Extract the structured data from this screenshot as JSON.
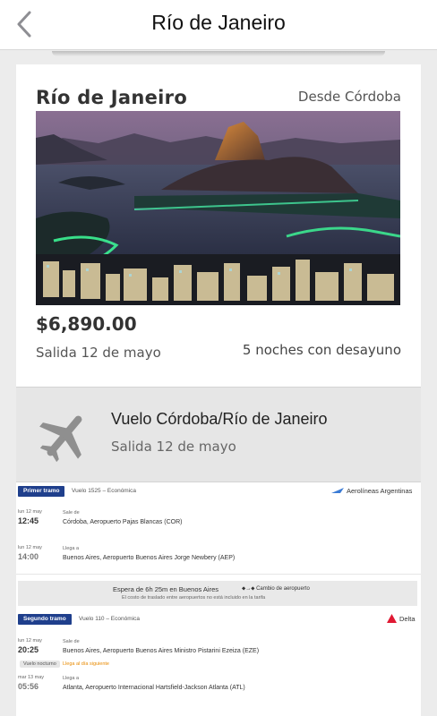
{
  "nav": {
    "title": "Río de Janeiro"
  },
  "package": {
    "destination": "Río de Janeiro",
    "origin": "Desde Córdoba",
    "price": "$6,890.00",
    "departure": "Salida 12 de mayo",
    "nights": "5 noches con desayuno"
  },
  "flight": {
    "title": "Vuelo Córdoba/Río de Janeiro",
    "date": "Salida 12 de mayo"
  },
  "itinerary": {
    "leg1": {
      "badge": "Primer tramo",
      "flight": "Vuelo 1525 – Económica",
      "airline": "Aerolíneas Argentinas",
      "dep_date": "lun 12 may",
      "dep_time": "12:45",
      "dep_label": "Sale de",
      "dep_place": "Córdoba, Aeropuerto Pajas Blancas (COR)",
      "arr_date": "lun 12 may",
      "arr_time": "14:00",
      "arr_label": "Llega a",
      "arr_place": "Buenos Aires, Aeropuerto Buenos Aires Jorge Newbery (AEP)"
    },
    "wait": {
      "text": "Espera de 6h 25m en Buenos Aires",
      "change": "Cambio de aeropuerto",
      "note": "El costo de traslado entre aeropuertos no está incluido en la tarifa"
    },
    "leg2": {
      "badge": "Segundo tramo",
      "flight": "Vuelo 110 – Económica",
      "airline": "Delta",
      "dep_date": "lun 12 may",
      "dep_time": "20:25",
      "dep_label": "Sale de",
      "dep_place": "Buenos Aires, Aeropuerto Buenos Aires Ministro Pistarini Ezeiza (EZE)",
      "night_pill": "Vuelo nocturno",
      "next_day": "Llega al día siguiente",
      "arr_date": "mar 13 may",
      "arr_time": "05:56",
      "arr_label": "Llega a",
      "arr_place": "Atlanta, Aeropuerto Internacional Hartsfield-Jackson Atlanta (ATL)"
    }
  },
  "colors": {
    "badge": "#1f3f8c",
    "delta": "#e01933",
    "accent_orange": "#e88a00",
    "flight_bg": "#e6e6e6"
  }
}
